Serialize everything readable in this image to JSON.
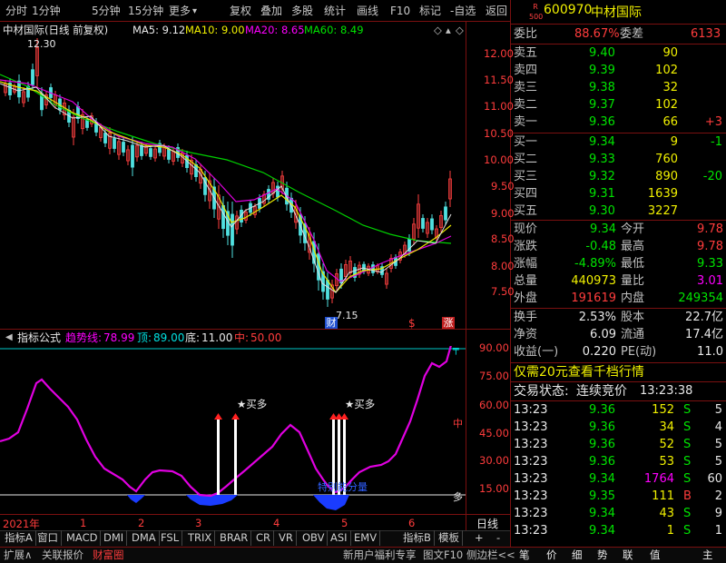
{
  "toolbar": {
    "left": [
      "分时",
      "1分钟",
      "5分钟",
      "15分钟",
      "更多"
    ],
    "right": [
      "复权",
      "叠加",
      "多股",
      "统计",
      "画线",
      "F10",
      "标记",
      "-自选",
      "返回"
    ],
    "more_arrow": "▾"
  },
  "chart_title": {
    "stock": "中材国际(日线 前复权)",
    "ma5": "MA5: 9.12",
    "ma10": "MA10: 9.00",
    "ma20": "MA20: 8.65",
    "ma60": "MA60: 8.49",
    "icons": [
      "◇",
      "▴",
      "◇"
    ]
  },
  "price_labels": {
    "high": "12.30",
    "low": "7.15"
  },
  "price_axis": [
    "12.00",
    "11.50",
    "11.00",
    "10.50",
    "10.00",
    "9.50",
    "9.00",
    "8.50",
    "8.00",
    "7.50"
  ],
  "event_markers": [
    "财",
    "$",
    "涨"
  ],
  "indicator": {
    "name": "指标公式",
    "trend_label": "趋势线:",
    "trend_value": "78.99",
    "top_label": "顶:",
    "top_value": "89.00",
    "bottom_label": "底:",
    "bottom_value": "11.00",
    "mid_label": "中:",
    "mid_value": "50.00",
    "axis": [
      "90.00",
      "75.00",
      "60.00",
      "45.00",
      "30.00",
      "15.00"
    ],
    "side_marks": {
      "top": "╤",
      "mid": "中",
      "low": "多"
    },
    "buy_label": "★买多",
    "annotation": "特别能分量"
  },
  "date_axis": {
    "year": "2021年",
    "months": [
      "1",
      "2",
      "3",
      "4",
      "5",
      "6"
    ],
    "period": "日线"
  },
  "bottom_tabs": [
    "指标A",
    "窗口",
    "MACD",
    "DMI",
    "DMA",
    "FSL",
    "TRIX",
    "BRAR",
    "CR",
    "VR",
    "OBV",
    "ASI",
    "EMV",
    "指标B",
    "模板",
    "+",
    "-"
  ],
  "status_bar": {
    "left": [
      "扩展∧",
      "关联报价",
      "财富圈"
    ],
    "right": [
      "新用户福利专享",
      "图文F10",
      "侧边栏<<"
    ],
    "func_keys": [
      "笔",
      "价",
      "细",
      "势",
      "联",
      "值",
      "主"
    ]
  },
  "quote": {
    "badge": "R 500",
    "code": "600970",
    "name": "中材国际",
    "weibi_label": "委比",
    "weibi": "88.67%",
    "weicha_label": "委差",
    "weicha": "6133",
    "sells": [
      {
        "label": "卖五",
        "price": "9.40",
        "vol": "90"
      },
      {
        "label": "卖四",
        "price": "9.39",
        "vol": "102"
      },
      {
        "label": "卖三",
        "price": "9.38",
        "vol": "32"
      },
      {
        "label": "卖二",
        "price": "9.37",
        "vol": "102"
      },
      {
        "label": "卖一",
        "price": "9.36",
        "vol": "66",
        "chg": "+3"
      }
    ],
    "buys": [
      {
        "label": "买一",
        "price": "9.34",
        "vol": "9",
        "chg": "-1"
      },
      {
        "label": "买二",
        "price": "9.33",
        "vol": "760",
        "chg": ""
      },
      {
        "label": "买三",
        "price": "9.32",
        "vol": "890",
        "chg": "-20"
      },
      {
        "label": "买四",
        "price": "9.31",
        "vol": "1639",
        "chg": ""
      },
      {
        "label": "买五",
        "price": "9.30",
        "vol": "3227",
        "chg": ""
      }
    ],
    "stats": [
      {
        "l1": "现价",
        "v1": "9.34",
        "l2": "今开",
        "v2": "9.78"
      },
      {
        "l1": "涨跌",
        "v1": "-0.48",
        "l2": "最高",
        "v2": "9.78"
      },
      {
        "l1": "涨幅",
        "v1": "-4.89%",
        "l2": "最低",
        "v2": "9.33"
      },
      {
        "l1": "总量",
        "v1": "440973",
        "l2": "量比",
        "v2": "3.01"
      },
      {
        "l1": "外盘",
        "v1": "191619",
        "l2": "内盘",
        "v2": "249354"
      }
    ],
    "fund": [
      {
        "l1": "换手",
        "v1": "2.53%",
        "l2": "股本",
        "v2": "22.7亿"
      },
      {
        "l1": "净资",
        "v1": "6.09",
        "l2": "流通",
        "v2": "17.4亿"
      },
      {
        "l1": "收益(一)",
        "v1": "0.220",
        "l2": "PE(动)",
        "v2": "11.0"
      }
    ],
    "promo": "仅需20元查看千档行情",
    "trade_status_label": "交易状态:",
    "trade_status": "连续竞价",
    "trade_time": "13:23:38",
    "ticks": [
      {
        "t": "13:23",
        "p": "9.36",
        "v": "152",
        "s": "S",
        "n": "5"
      },
      {
        "t": "13:23",
        "p": "9.36",
        "v": "34",
        "s": "S",
        "n": "4"
      },
      {
        "t": "13:23",
        "p": "9.36",
        "v": "52",
        "s": "S",
        "n": "5"
      },
      {
        "t": "13:23",
        "p": "9.36",
        "v": "53",
        "s": "S",
        "n": "5"
      },
      {
        "t": "13:23",
        "p": "9.34",
        "v": "1764",
        "s": "S",
        "n": "60"
      },
      {
        "t": "13:23",
        "p": "9.35",
        "v": "111",
        "s": "B",
        "n": "2"
      },
      {
        "t": "13:23",
        "p": "9.34",
        "v": "43",
        "s": "S",
        "n": "9"
      },
      {
        "t": "13:23",
        "p": "9.34",
        "v": "1",
        "s": "S",
        "n": "1"
      }
    ]
  }
}
